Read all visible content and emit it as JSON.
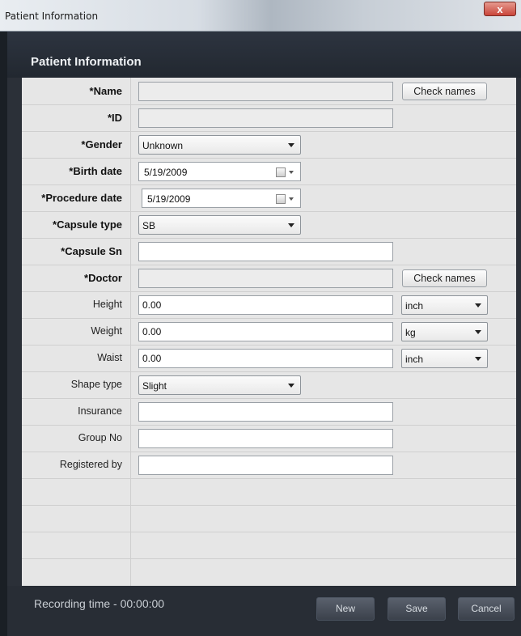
{
  "window": {
    "title": "Patient Information",
    "close_glyph": "x"
  },
  "section_title": "Patient Information",
  "fields": {
    "name": {
      "label": "*Name",
      "value": ""
    },
    "id": {
      "label": "*ID",
      "value": ""
    },
    "gender": {
      "label": "*Gender",
      "value": "Unknown"
    },
    "birth_date": {
      "label": "*Birth date",
      "value": "5/19/2009"
    },
    "procedure_date": {
      "label": "*Procedure date",
      "value": "5/19/2009"
    },
    "capsule_type": {
      "label": "*Capsule type",
      "value": "SB"
    },
    "capsule_sn": {
      "label": "*Capsule Sn",
      "value": ""
    },
    "doctor": {
      "label": "*Doctor",
      "value": ""
    },
    "height": {
      "label": "Height",
      "value": "0.00",
      "unit": "inch"
    },
    "weight": {
      "label": "Weight",
      "value": "0.00",
      "unit": "kg"
    },
    "waist": {
      "label": "Waist",
      "value": "0.00",
      "unit": "inch"
    },
    "shape_type": {
      "label": "Shape type",
      "value": "Slight"
    },
    "insurance": {
      "label": "Insurance",
      "value": ""
    },
    "group_no": {
      "label": "Group No",
      "value": ""
    },
    "registered_by": {
      "label": "Registered by",
      "value": ""
    }
  },
  "buttons": {
    "check_names": "Check names",
    "new": "New",
    "save": "Save",
    "cancel": "Cancel"
  },
  "footer": {
    "recording_time": "Recording time - 00:00:00"
  }
}
